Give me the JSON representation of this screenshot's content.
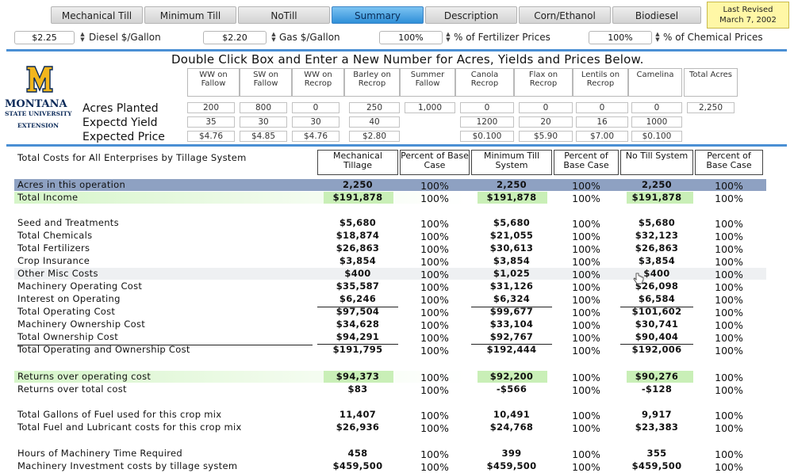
{
  "tabs": [
    "Mechanical Till",
    "Minimum Till",
    "NoTill",
    "Summary",
    "Description",
    "Corn/Ethanol",
    "Biodiesel"
  ],
  "active_tab": "Summary",
  "last_revised": {
    "line1": "Last Revised",
    "line2": "March 7, 2002"
  },
  "prices": {
    "diesel": {
      "value": "$2.25",
      "label": "Diesel $/Gallon"
    },
    "gas": {
      "value": "$2.20",
      "label": "Gas $/Gallon"
    },
    "fertilizer": {
      "value": "100%",
      "label": "% of Fertilizer Prices"
    },
    "chemical": {
      "value": "100%",
      "label": "% of Chemical Prices"
    }
  },
  "instruction": "Double Click Box and Enter a New Number for Acres, Yields and Prices Below.",
  "logo": {
    "line1": "MONTANA",
    "line2": "STATE UNIVERSITY",
    "line3": "EXTENSION"
  },
  "input_grid": {
    "row_labels": [
      "Acres Planted",
      "Expectd Yield",
      "Expected Price"
    ],
    "crops": [
      "WW on Fallow",
      "SW on Fallow",
      "WW on Recrop",
      "Barley on Recrop",
      "Summer Fallow",
      "Canola Recrop",
      "Flax on Recrop",
      "Lentils on Recrop",
      "Camelina"
    ],
    "total_header": "Total Acres",
    "acres": [
      "200",
      "800",
      "0",
      "250",
      "1,000",
      "0",
      "0",
      "0",
      "0"
    ],
    "total_acres": "2,250",
    "yields": [
      "35",
      "30",
      "30",
      "40",
      "",
      "1200",
      "20",
      "16",
      "1000"
    ],
    "prices": [
      "$4.76",
      "$4.85",
      "$4.76",
      "$2.80",
      "",
      "$0.100",
      "$5.90",
      "$7.00",
      "$0.100"
    ]
  },
  "results": {
    "title": "Total Costs for All Enterprises by Tillage System",
    "headers": [
      "Mechanical Tillage",
      "Percent of Base Case",
      "Minimum Till System",
      "Percent of Base Case",
      "No Till System",
      "Percent of Base Case"
    ],
    "rows": [
      {
        "label": "Acres in this operation",
        "mech": "2,250",
        "min": "2,250",
        "no": "2,250",
        "p1": "100%",
        "p2": "100%",
        "p3": "100%"
      },
      {
        "label": "Total Income",
        "mech": "$191,878",
        "min": "$191,878",
        "no": "$191,878",
        "p1": "100%",
        "p2": "100%",
        "p3": "100%"
      },
      {
        "label": "Seed and Treatments",
        "mech": "$5,680",
        "min": "$5,680",
        "no": "$5,680",
        "p1": "100%",
        "p2": "100%",
        "p3": "100%"
      },
      {
        "label": "Total Chemicals",
        "mech": "$18,874",
        "min": "$21,055",
        "no": "$32,123",
        "p1": "100%",
        "p2": "100%",
        "p3": "100%"
      },
      {
        "label": "Total Fertilizers",
        "mech": "$26,863",
        "min": "$30,613",
        "no": "$26,863",
        "p1": "100%",
        "p2": "100%",
        "p3": "100%"
      },
      {
        "label": "Crop Insurance",
        "mech": "$3,854",
        "min": "$3,854",
        "no": "$3,854",
        "p1": "100%",
        "p2": "100%",
        "p3": "100%"
      },
      {
        "label": "Other Misc Costs",
        "mech": "$400",
        "min": "$1,025",
        "no": "$400",
        "p1": "100%",
        "p2": "100%",
        "p3": "100%"
      },
      {
        "label": "Machinery Operating Cost",
        "mech": "$35,587",
        "min": "$31,126",
        "no": "$26,098",
        "p1": "100%",
        "p2": "100%",
        "p3": "100%"
      },
      {
        "label": "Interest on Operating",
        "mech": "$6,246",
        "min": "$6,324",
        "no": "$6,584",
        "p1": "100%",
        "p2": "100%",
        "p3": "100%"
      },
      {
        "label": "Total Operating Cost",
        "mech": "$97,504",
        "min": "$99,677",
        "no": "$101,602",
        "p1": "100%",
        "p2": "100%",
        "p3": "100%"
      },
      {
        "label": "Machinery Ownership Cost",
        "mech": "$34,628",
        "min": "$33,104",
        "no": "$30,741",
        "p1": "100%",
        "p2": "100%",
        "p3": "100%"
      },
      {
        "label": "Total Ownership Cost",
        "mech": "$94,291",
        "min": "$92,767",
        "no": "$90,404",
        "p1": "100%",
        "p2": "100%",
        "p3": "100%"
      },
      {
        "label": "Total Operating and Ownership Cost",
        "mech": "$191,795",
        "min": "$192,444",
        "no": "$192,006",
        "p1": "100%",
        "p2": "100%",
        "p3": "100%"
      },
      {
        "label": "Returns over operating cost",
        "mech": "$94,373",
        "min": "$92,200",
        "no": "$90,276",
        "p1": "100%",
        "p2": "100%",
        "p3": "100%"
      },
      {
        "label": "Returns over total cost",
        "mech": "$83",
        "min": "-$566",
        "no": "-$128",
        "p1": "100%",
        "p2": "100%",
        "p3": "100%"
      },
      {
        "label": "Total Gallons of Fuel used for this crop mix",
        "mech": "11,407",
        "min": "10,491",
        "no": "9,917",
        "p1": "100%",
        "p2": "100%",
        "p3": "100%"
      },
      {
        "label": "Total Fuel and Lubricant costs for this crop mix",
        "mech": "$26,936",
        "min": "$24,768",
        "no": "$23,383",
        "p1": "100%",
        "p2": "100%",
        "p3": "100%"
      },
      {
        "label": "Hours of Machinery Time Required",
        "mech": "458",
        "min": "399",
        "no": "355",
        "p1": "100%",
        "p2": "100%",
        "p3": "100%"
      },
      {
        "label": "Machinery Investment costs by tillage system",
        "mech": "$459,500",
        "min": "$459,500",
        "no": "$459,500",
        "p1": "100%",
        "p2": "100%",
        "p3": "100%"
      }
    ]
  },
  "colors": {
    "accent_blue": "#4a8fd4",
    "highlight_green": "#d5f5c8",
    "highlight_blue": "#8ea1c2",
    "revised_yellow": "#fff7a6"
  }
}
